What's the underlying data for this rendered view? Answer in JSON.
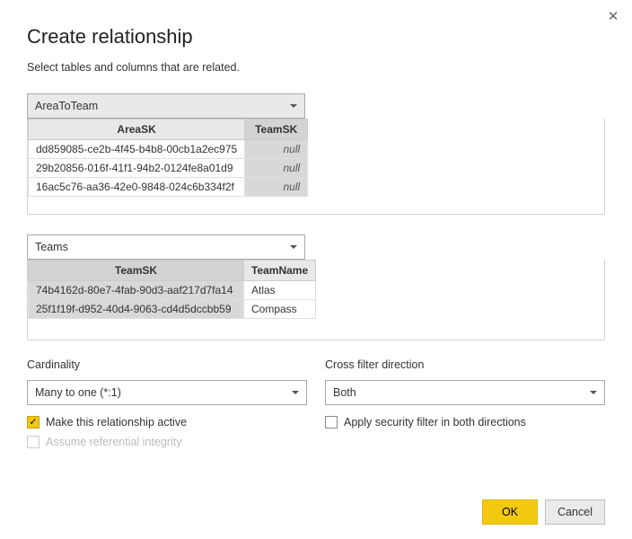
{
  "header": {
    "title": "Create relationship",
    "subtitle": "Select tables and columns that are related."
  },
  "table1": {
    "selected": "AreaToTeam",
    "columns": [
      "AreaSK",
      "TeamSK"
    ],
    "rows": [
      {
        "areask": "dd859085-ce2b-4f45-b4b8-00cb1a2ec975",
        "teamsk": "null"
      },
      {
        "areask": "29b20856-016f-41f1-94b2-0124fe8a01d9",
        "teamsk": "null"
      },
      {
        "areask": "16ac5c76-aa36-42e0-9848-024c6b334f2f",
        "teamsk": "null"
      }
    ]
  },
  "table2": {
    "selected": "Teams",
    "columns": [
      "TeamSK",
      "TeamName"
    ],
    "rows": [
      {
        "teamsk": "74b4162d-80e7-4fab-90d3-aaf217d7fa14",
        "teamname": "Atlas"
      },
      {
        "teamsk": "25f1f19f-d952-40d4-9063-cd4d5dccbb59",
        "teamname": "Compass"
      }
    ]
  },
  "cardinality": {
    "label": "Cardinality",
    "value": "Many to one (*:1)"
  },
  "crossfilter": {
    "label": "Cross filter direction",
    "value": "Both"
  },
  "checks": {
    "active": "Make this relationship active",
    "integrity": "Assume referential integrity",
    "security": "Apply security filter in both directions"
  },
  "buttons": {
    "ok": "OK",
    "cancel": "Cancel"
  }
}
